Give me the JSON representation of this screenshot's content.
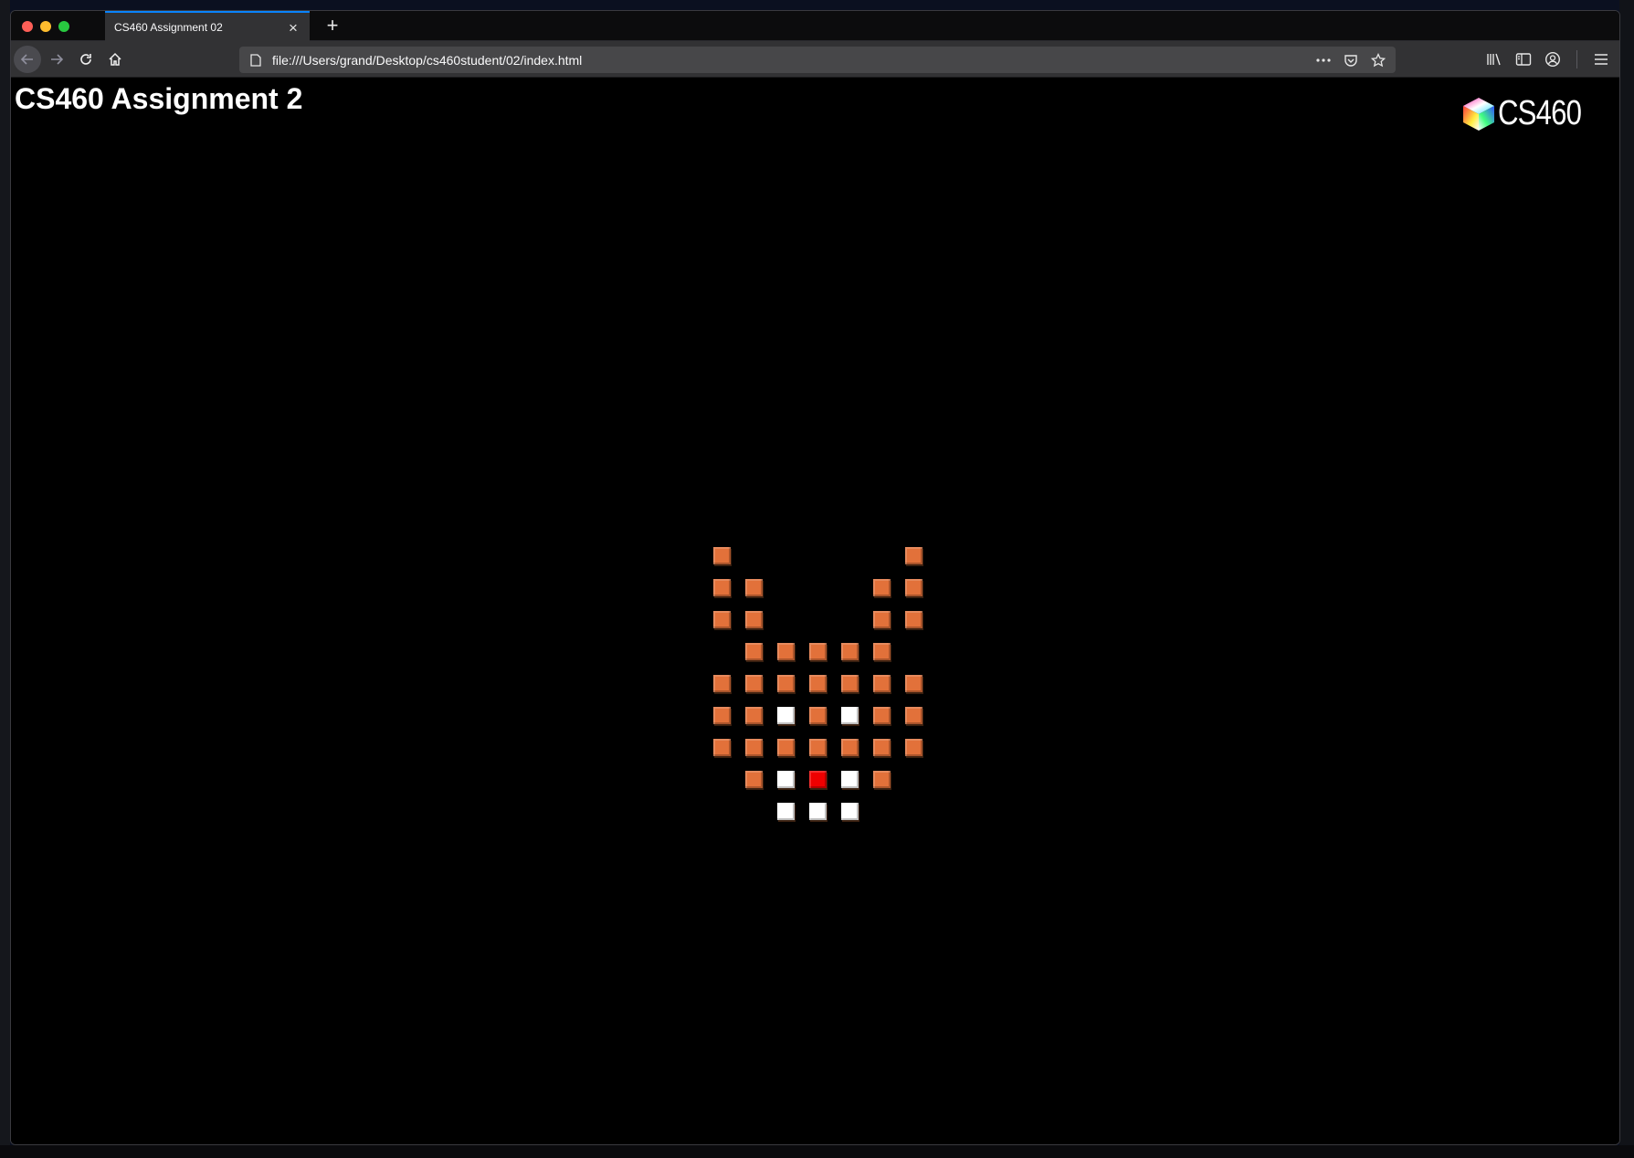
{
  "browser": {
    "tab": {
      "title": "CS460 Assignment 02"
    },
    "url": "file:///Users/grand/Desktop/cs460student/02/index.html",
    "icons": {
      "back": "back-arrow-icon",
      "forward": "forward-arrow-icon",
      "reload": "reload-icon",
      "home": "home-icon",
      "page": "page-icon",
      "more": "more-actions-icon",
      "pocket": "pocket-icon",
      "bookmark": "bookmark-star-icon",
      "library": "library-icon",
      "sidebar": "sidebar-icon",
      "account": "account-icon",
      "menu": "hamburger-menu-icon"
    }
  },
  "page": {
    "title": "CS460 Assignment 2",
    "logo_text": "CS460",
    "colors": {
      "background": "#000000",
      "orange": "#e2713a",
      "white": "#ffffff",
      "red": "#ee0000"
    },
    "voxel_grid": {
      "rows": [
        [
          "o",
          ".",
          ".",
          ".",
          ".",
          ".",
          "o"
        ],
        [
          "o",
          "o",
          ".",
          ".",
          ".",
          "o",
          "o"
        ],
        [
          "o",
          "o",
          ".",
          ".",
          ".",
          "o",
          "o"
        ],
        [
          ".",
          "o",
          "o",
          "o",
          "o",
          "o",
          "."
        ],
        [
          "o",
          "o",
          "o",
          "o",
          "o",
          "o",
          "o"
        ],
        [
          "o",
          "o",
          "w",
          "o",
          "w",
          "o",
          "o"
        ],
        [
          "o",
          "o",
          "o",
          "o",
          "o",
          "o",
          "o"
        ],
        [
          ".",
          "o",
          "w",
          "r",
          "w",
          "o",
          "."
        ],
        [
          ".",
          ".",
          "w",
          "w",
          "w",
          ".",
          "."
        ]
      ],
      "legend": {
        "o": "orange",
        "w": "white",
        "r": "red"
      }
    }
  }
}
